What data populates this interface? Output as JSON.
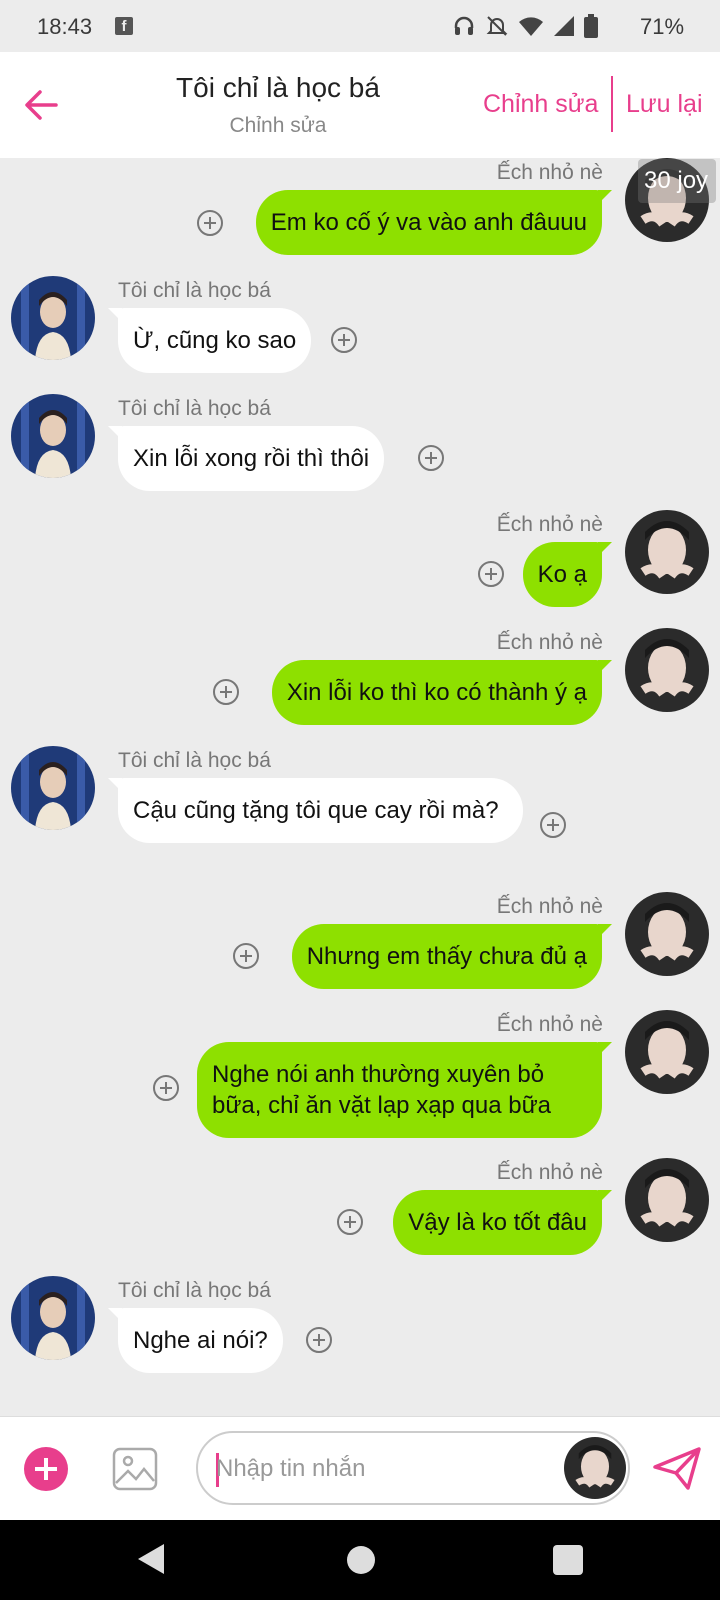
{
  "status_bar": {
    "time": "18:43",
    "battery": "71%"
  },
  "header": {
    "title": "Tôi chỉ là học bá",
    "subtitle": "Chỉnh sửa",
    "edit_label": "Chỉnh sửa",
    "save_label": "Lưu lại",
    "accent_color": "#e83e8c"
  },
  "overlay_badge": "30 joy",
  "messages": [
    {
      "side": "me",
      "sender": "Ếch nhỏ nè",
      "text": "Em ko cố ý va vào anh đâuuu"
    },
    {
      "side": "them",
      "sender": "Tôi chỉ là học bá",
      "text": "Ừ, cũng ko sao"
    },
    {
      "side": "them",
      "sender": "Tôi chỉ là học bá",
      "text": "Xin lỗi xong rồi thì thôi"
    },
    {
      "side": "me",
      "sender": "Ếch nhỏ nè",
      "text": "Ko ạ"
    },
    {
      "side": "me",
      "sender": "Ếch nhỏ nè",
      "text": "Xin lỗi ko thì ko có thành ý ạ"
    },
    {
      "side": "them",
      "sender": "Tôi chỉ là học bá",
      "text": "Cậu cũng tặng tôi que cay rồi mà?"
    },
    {
      "side": "me",
      "sender": "Ếch nhỏ nè",
      "text": "Nhưng em thấy chưa đủ ạ"
    },
    {
      "side": "me",
      "sender": "Ếch nhỏ nè",
      "text": "Nghe nói anh thường xuyên bỏ bữa, chỉ ăn vặt lạp xạp qua bữa"
    },
    {
      "side": "me",
      "sender": "Ếch nhỏ nè",
      "text": "Vậy là ko tốt đâu"
    },
    {
      "side": "them",
      "sender": "Tôi chỉ là học bá",
      "text": "Nghe ai nói?"
    }
  ],
  "input": {
    "placeholder": "Nhập tin nhắn"
  },
  "colors": {
    "my_bubble": "#8ee000",
    "their_bubble": "#ffffff",
    "background": "#ececec"
  }
}
